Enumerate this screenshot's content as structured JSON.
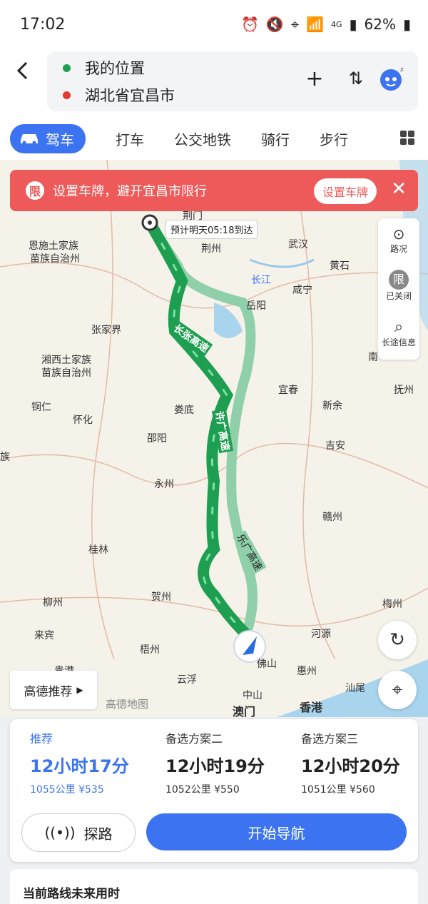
{
  "status_bar": {
    "time": "17:02",
    "battery": "62%",
    "network": "4G"
  },
  "search": {
    "from": "我的位置",
    "to": "湖北省宜昌市"
  },
  "tabs": [
    "驾车",
    "打车",
    "公交地铁",
    "骑行",
    "步行"
  ],
  "banner": {
    "icon_text": "限",
    "message": "设置车牌，避开宜昌市限行",
    "button": "设置车牌"
  },
  "side_panel": {
    "traffic": "路况",
    "restriction_icon": "限",
    "restriction": "已关闭",
    "long_trip": "长途信息"
  },
  "map": {
    "eta": "预计明天05:18到达",
    "cities": [
      "荆门",
      "荆州",
      "武汉",
      "黄石",
      "恩施土家族",
      "苗族自治州",
      "长江",
      "岳阳",
      "咸宁",
      "张家界",
      "湘西土家族",
      "苗族自治州",
      "南",
      "宜春",
      "抚州",
      "铜仁",
      "怀化",
      "娄底",
      "新余",
      "邵阳",
      "吉安",
      "永州",
      "赣州",
      "桂林",
      "柳州",
      "贺州",
      "梅州",
      "来宾",
      "梧州",
      "河源",
      "云浮",
      "惠州",
      "汕尾",
      "中山",
      "澳门",
      "香港",
      "佛山",
      "贵港",
      "族"
    ],
    "roads": [
      "长张高速",
      "许广高速",
      "乐广高速"
    ],
    "watermark": "高德地图"
  },
  "gaode_recommend": "高德推荐",
  "routes": [
    {
      "title": "推荐",
      "duration": "12小时17分",
      "distance": "1055公里",
      "cost": "¥535"
    },
    {
      "title": "备选方案二",
      "duration": "12小时19分",
      "distance": "1052公里",
      "cost": "¥550"
    },
    {
      "title": "备选方案三",
      "duration": "12小时20分",
      "distance": "1051公里",
      "cost": "¥560"
    }
  ],
  "explore_label": "探路",
  "start_label": "开始导航",
  "future_label": "当前路线未来用时",
  "colors": {
    "accent": "#3b73f0",
    "banner": "#ee5a5a",
    "route_main": "#1e9e50",
    "route_alt": "#8fcfaa"
  }
}
